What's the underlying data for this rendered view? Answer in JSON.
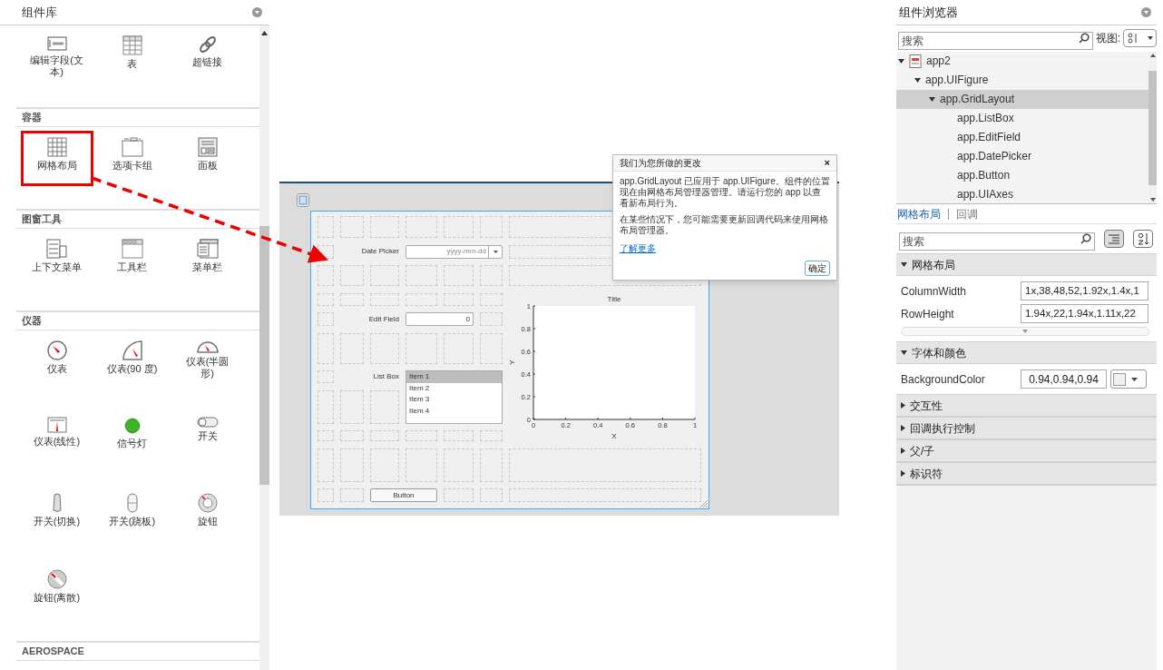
{
  "palette": {
    "title": "组件库",
    "sections": [
      {
        "items": [
          {
            "label": "编辑字段(文本)",
            "highlighted": false
          },
          {
            "label": "表",
            "highlighted": false
          },
          {
            "label": "超链接",
            "highlighted": false
          }
        ]
      },
      {
        "title": "容器",
        "items": [
          {
            "label": "网格布局",
            "highlighted": true
          },
          {
            "label": "选项卡组",
            "highlighted": false
          },
          {
            "label": "面板",
            "highlighted": false
          }
        ]
      },
      {
        "title": "图窗工具",
        "items": [
          {
            "label": "上下文菜单",
            "highlighted": false
          },
          {
            "label": "工具栏",
            "highlighted": false
          },
          {
            "label": "菜单栏",
            "highlighted": false
          }
        ]
      },
      {
        "title": "仪器",
        "items": [
          {
            "label": "仪表",
            "highlighted": false
          },
          {
            "label": "仪表(90 度)",
            "highlighted": false
          },
          {
            "label": "仪表(半圆形)",
            "highlighted": false
          },
          {
            "label": "仪表(线性)",
            "highlighted": false
          },
          {
            "label": "信号灯",
            "highlighted": false
          },
          {
            "label": "开关",
            "highlighted": false
          },
          {
            "label": "开关(切换)",
            "highlighted": false
          },
          {
            "label": "开关(跷板)",
            "highlighted": false
          },
          {
            "label": "旋钮",
            "highlighted": false
          },
          {
            "label": "旋钮(离散)",
            "highlighted": false
          }
        ]
      },
      {
        "title": "AEROSPACE"
      }
    ]
  },
  "designer": {
    "date_picker": {
      "label": "Date Picker",
      "placeholder": "yyyy-mm-dd"
    },
    "edit_field": {
      "label": "Edit Field",
      "value": "0"
    },
    "list_box": {
      "label": "List Box",
      "items": [
        {
          "text": "Item 1",
          "selected": true
        },
        {
          "text": "Item 2",
          "selected": false
        },
        {
          "text": "Item 3",
          "selected": false
        },
        {
          "text": "Item 4",
          "selected": false
        }
      ]
    },
    "axes": {
      "chart_data": {
        "type": "line",
        "title": "Title",
        "xlabel": "X",
        "ylabel": "Y",
        "xlim": [
          0,
          1
        ],
        "ylim": [
          0,
          1
        ],
        "xticks": [
          0,
          0.2,
          0.4,
          0.6,
          0.8,
          1
        ],
        "yticks": [
          0,
          0.2,
          0.4,
          0.6,
          0.8,
          1
        ]
      }
    },
    "button": {
      "label": "Button"
    },
    "dialog": {
      "title": "我们为您所做的更改",
      "close": "×",
      "paragraphs": [
        "app.GridLayout 已应用于 app.UIFigure。组件的位置现在由网格布局管理器管理。请运行您的 app 以查看新布局行为。",
        "在某些情况下，您可能需要更新回调代码来使用网格布局管理器。"
      ],
      "link": "了解更多",
      "button": "确定"
    }
  },
  "browser": {
    "title": "组件浏览器",
    "search": {
      "placeholder": "搜索"
    },
    "view_label": "视图:",
    "tree": [
      {
        "label": "app2",
        "expanded": true,
        "selected": false,
        "children": [
          {
            "label": "app.UIFigure",
            "expanded": true,
            "selected": false,
            "children": [
              {
                "label": "app.GridLayout",
                "expanded": true,
                "selected": true,
                "children": [
                  {
                    "label": "app.ListBox",
                    "selected": false
                  },
                  {
                    "label": "app.EditField",
                    "selected": false
                  },
                  {
                    "label": "app.DatePicker",
                    "selected": false
                  },
                  {
                    "label": "app.Button",
                    "selected": false
                  },
                  {
                    "label": "app.UIAxes",
                    "selected": false
                  }
                ]
              }
            ]
          }
        ]
      }
    ]
  },
  "inspector": {
    "tabs": [
      {
        "label": "网格布局",
        "selected": true
      },
      {
        "label": "回调",
        "selected": false
      }
    ],
    "search": {
      "placeholder": "搜索"
    },
    "sections": [
      {
        "title": "网格布局",
        "expanded": true,
        "has_more": true,
        "properties": [
          {
            "name": "ColumnWidth",
            "value": "1x,38,48,52,1.92x,1.4x,1",
            "kind": "text"
          },
          {
            "name": "RowHeight",
            "value": "1.94x,22,1.94x,1.11x,22",
            "kind": "text"
          }
        ]
      },
      {
        "title": "字体和颜色",
        "expanded": true,
        "properties": [
          {
            "name": "BackgroundColor",
            "value": "0.94,0.94,0.94",
            "kind": "color"
          }
        ]
      },
      {
        "title": "交互性",
        "expanded": false
      },
      {
        "title": "回调执行控制",
        "expanded": false
      },
      {
        "title": "父/子",
        "expanded": false
      },
      {
        "title": "标识符",
        "expanded": false
      }
    ]
  }
}
